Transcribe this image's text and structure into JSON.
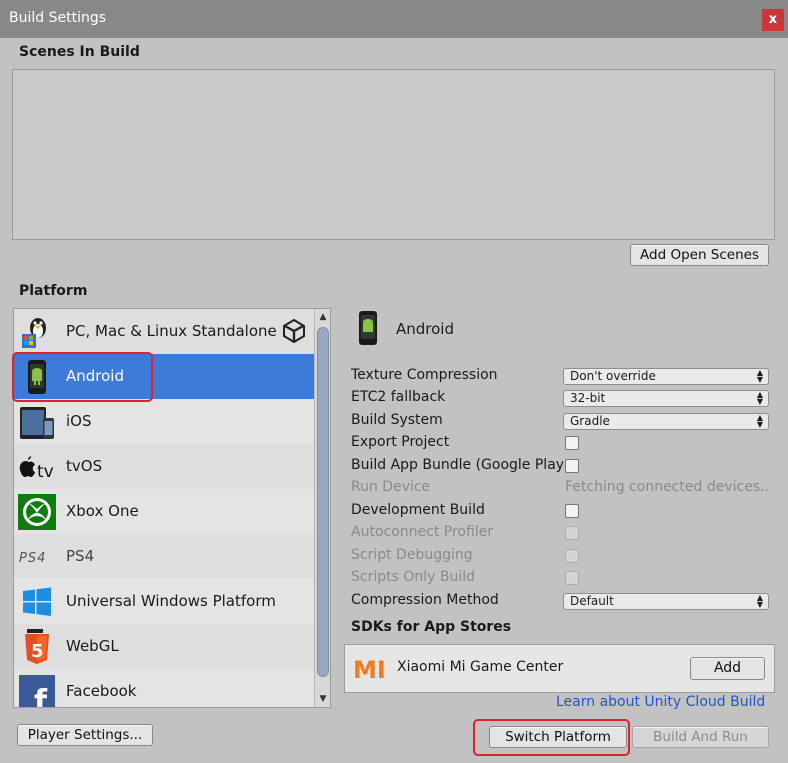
{
  "window": {
    "title": "Build Settings",
    "close_glyph": "x"
  },
  "scenes": {
    "heading": "Scenes In Build",
    "add_open_scenes_label": "Add Open Scenes"
  },
  "platform": {
    "heading": "Platform",
    "items": [
      {
        "label": "PC, Mac & Linux Standalone",
        "icon": "pc-mac-linux-icon"
      },
      {
        "label": "Android",
        "icon": "android-icon",
        "selected": true
      },
      {
        "label": "iOS",
        "icon": "ios-icon"
      },
      {
        "label": "tvOS",
        "icon": "tvos-icon"
      },
      {
        "label": "Xbox One",
        "icon": "xbox-icon"
      },
      {
        "label": "PS4",
        "icon": "ps4-icon"
      },
      {
        "label": "Universal Windows Platform",
        "icon": "windows-icon"
      },
      {
        "label": "WebGL",
        "icon": "html5-icon"
      },
      {
        "label": "Facebook",
        "icon": "facebook-icon"
      }
    ],
    "tvos_text": "tv",
    "ps4_text": "PS4",
    "html5_text": "5",
    "facebook_text": "f"
  },
  "android_settings": {
    "header_label": "Android",
    "texture_compression": {
      "label": "Texture Compression",
      "value": "Don't override"
    },
    "etc2_fallback": {
      "label": "ETC2 fallback",
      "value": "32-bit"
    },
    "build_system": {
      "label": "Build System",
      "value": "Gradle"
    },
    "export_project": {
      "label": "Export Project",
      "checked": false
    },
    "build_app_bundle": {
      "label": "Build App Bundle (Google Play",
      "checked": false
    },
    "run_device": {
      "label": "Run Device",
      "value": "Fetching connected devices.."
    },
    "development_build": {
      "label": "Development Build",
      "checked": false
    },
    "autoconnect_profiler": {
      "label": "Autoconnect Profiler",
      "checked": false
    },
    "script_debugging": {
      "label": "Script Debugging",
      "checked": false
    },
    "scripts_only_build": {
      "label": "Scripts Only Build",
      "checked": false
    },
    "compression_method": {
      "label": "Compression Method",
      "value": "Default"
    }
  },
  "sdks": {
    "heading": "SDKs for App Stores",
    "logo_text": "MI",
    "items": [
      {
        "name": "Xiaomi Mi Game Center",
        "action_label": "Add"
      }
    ],
    "learn_link": "Learn about Unity Cloud Build"
  },
  "footer": {
    "player_settings_label": "Player Settings...",
    "switch_platform_label": "Switch Platform",
    "build_and_run_label": "Build And Run"
  },
  "colors": {
    "selection": "#3e7bd8",
    "highlight": "#e0222a",
    "link": "#2255cc",
    "mi_orange": "#f07c1e"
  }
}
